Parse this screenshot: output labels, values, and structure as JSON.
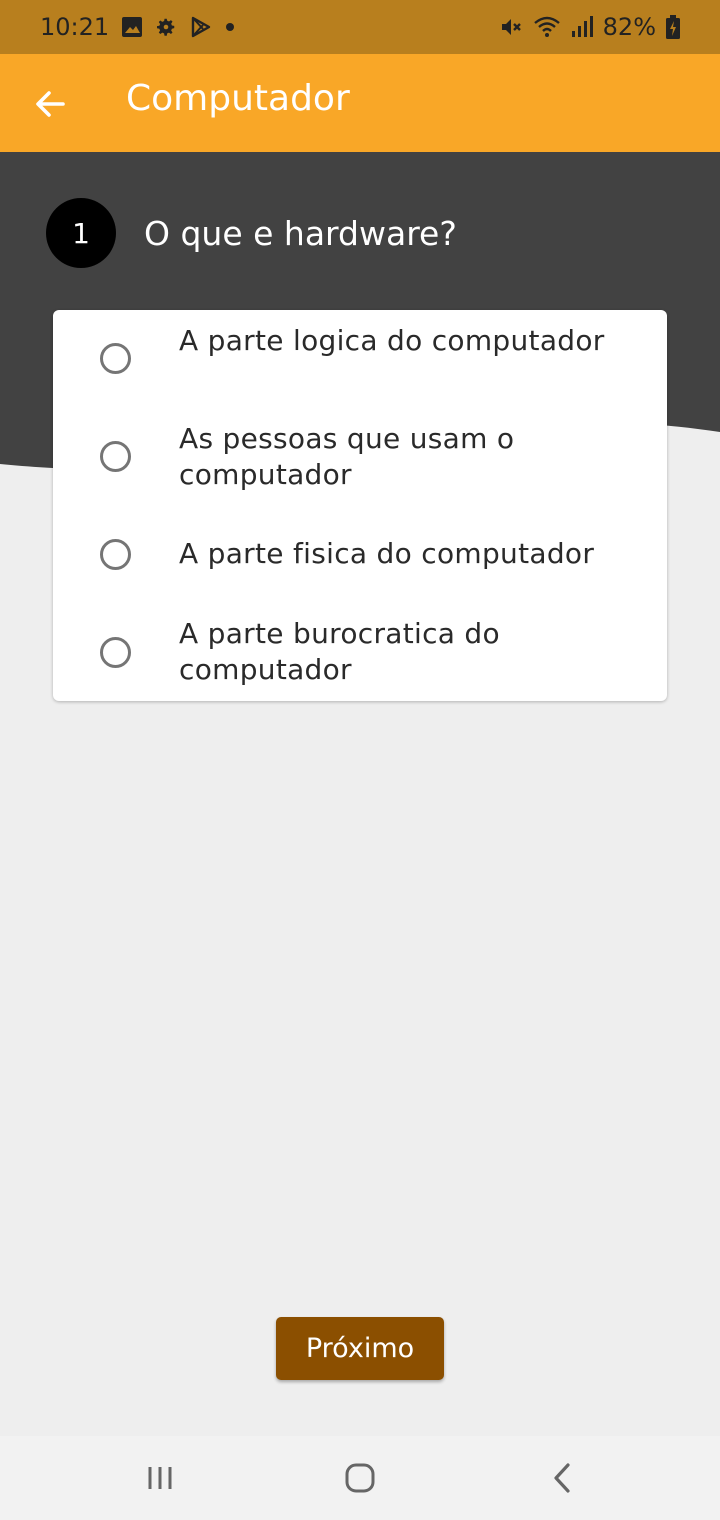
{
  "status_bar": {
    "time": "10:21",
    "battery": "82%",
    "icons": [
      "image-icon",
      "gear-icon",
      "play-store-icon",
      "dot-icon",
      "mute-icon",
      "wifi-icon",
      "signal-icon",
      "battery-charging-icon"
    ]
  },
  "app_bar": {
    "title": "Computador",
    "back_icon": "arrow-left-icon"
  },
  "question": {
    "number": "1",
    "text": "O que e hardware?"
  },
  "options": [
    {
      "label": "A parte logica do computador",
      "selected": false
    },
    {
      "label": "As pessoas que usam o computador",
      "selected": false
    },
    {
      "label": "A parte fisica do computador",
      "selected": false
    },
    {
      "label": "A parte burocratica do computador",
      "selected": false
    }
  ],
  "next_button": {
    "label": "Próximo"
  },
  "nav_bar": {
    "icons": [
      "recent-apps-icon",
      "home-icon",
      "back-icon"
    ]
  },
  "colors": {
    "status_bar": "#b87f1e",
    "app_bar": "#f9a727",
    "header_band": "#424242",
    "background": "#eeeeee",
    "button": "#8b4f00"
  }
}
